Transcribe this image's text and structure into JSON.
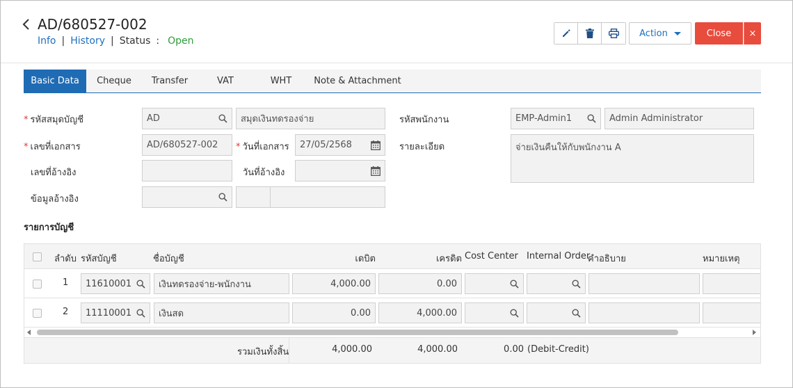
{
  "header": {
    "doc_no": "AD/680527-002",
    "info_link": "Info",
    "history_link": "History",
    "separator": "|",
    "status_label": "Status",
    "status_colon": ":",
    "status_value": "Open",
    "action_label": "Action",
    "close_label": "Close",
    "close_x": "×"
  },
  "tabs": [
    "Basic Data",
    "Cheque",
    "Transfer",
    "VAT",
    "WHT",
    "Note & Attachment"
  ],
  "form": {
    "journal_code_label": "รหัสสมุดบัญชี",
    "journal_code_value": "AD",
    "journal_name_value": "สมุดเงินทดรองจ่าย",
    "doc_no_label": "เลขที่เอกสาร",
    "doc_no_value": "AD/680527-002",
    "doc_date_label": "วันที่เอกสาร",
    "doc_date_value": "27/05/2568",
    "ref_no_label": "เลขที่อ้างอิง",
    "ref_no_value": "",
    "ref_date_label": "วันที่อ้างอิง",
    "ref_date_value": "",
    "ref_info_label": "ข้อมูลอ้างอิง",
    "ref_info_value": "",
    "employee_code_label": "รหัสพนักงาน",
    "employee_code_value": "EMP-Admin1",
    "employee_name_value": "Admin Administrator",
    "description_label": "รายละเอียด",
    "description_value": "จ่ายเงินคืนให้กับพนักงาน A"
  },
  "entries": {
    "section_title": "รายการบัญชี",
    "columns": {
      "seq": "ลำดับ",
      "account_code": "รหัสบัญชี",
      "account_name": "ชื่อบัญชี",
      "debit": "เดบิต",
      "credit": "เครดิต",
      "cost_center": "Cost Center",
      "internal_order": "Internal Order",
      "description": "คำอธิบาย",
      "remark": "หมายเหตุ"
    },
    "rows": [
      {
        "seq": "1",
        "account_code": "11610001",
        "account_name": "เงินทดรองจ่าย-พนักงาน",
        "debit": "4,000.00",
        "credit": "0.00"
      },
      {
        "seq": "2",
        "account_code": "11110001",
        "account_name": "เงินสด",
        "debit": "0.00",
        "credit": "4,000.00"
      }
    ],
    "total_label": "รวมเงินทั้งสิ้น",
    "total_debit": "4,000.00",
    "total_credit": "4,000.00",
    "total_diff": "0.00",
    "total_diff_note": "(Debit-Credit)"
  },
  "colors": {
    "primary": "#1f6cb5",
    "link": "#1e6fbf",
    "status_open": "#2e9c3a",
    "close_button": "#e84c3d",
    "required": "#e23a3a"
  }
}
